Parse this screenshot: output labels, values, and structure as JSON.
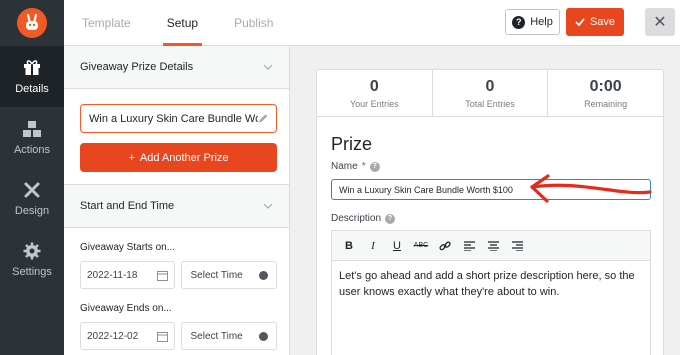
{
  "header": {
    "tabs": [
      {
        "label": "Template"
      },
      {
        "label": "Setup"
      },
      {
        "label": "Publish"
      }
    ],
    "help_label": "Help",
    "save_label": "Save",
    "accent_color": "#e8461f"
  },
  "sidebar": {
    "items": [
      {
        "label": "Details",
        "icon": "gift-icon"
      },
      {
        "label": "Actions",
        "icon": "cubes-icon"
      },
      {
        "label": "Design",
        "icon": "design-tools-icon"
      },
      {
        "label": "Settings",
        "icon": "gear-icon"
      }
    ]
  },
  "panel": {
    "prize_section_title": "Giveaway Prize Details",
    "prize_value": "Win a Luxury Skin Care Bundle Wo...",
    "add_prize_label": "Add Another Prize",
    "time_section_title": "Start and End Time",
    "starts_label": "Giveaway Starts on...",
    "start_date": "2022-11-18",
    "start_time_placeholder": "Select Time",
    "ends_label": "Giveaway Ends on...",
    "end_date": "2022-12-02",
    "end_time_placeholder": "Select Time"
  },
  "stats": [
    {
      "value": "0",
      "label": "Your Entries"
    },
    {
      "value": "0",
      "label": "Total Entries"
    },
    {
      "value": "0:00",
      "label": "Remaining"
    }
  ],
  "prize_form": {
    "title": "Prize",
    "name_label": "Name",
    "required_mark": "*",
    "name_value": "Win a Luxury Skin Care Bundle Worth $100",
    "description_label": "Description",
    "description_text": "Let's go ahead and add a short prize description here, so the user knows exactly what they're about to win."
  }
}
